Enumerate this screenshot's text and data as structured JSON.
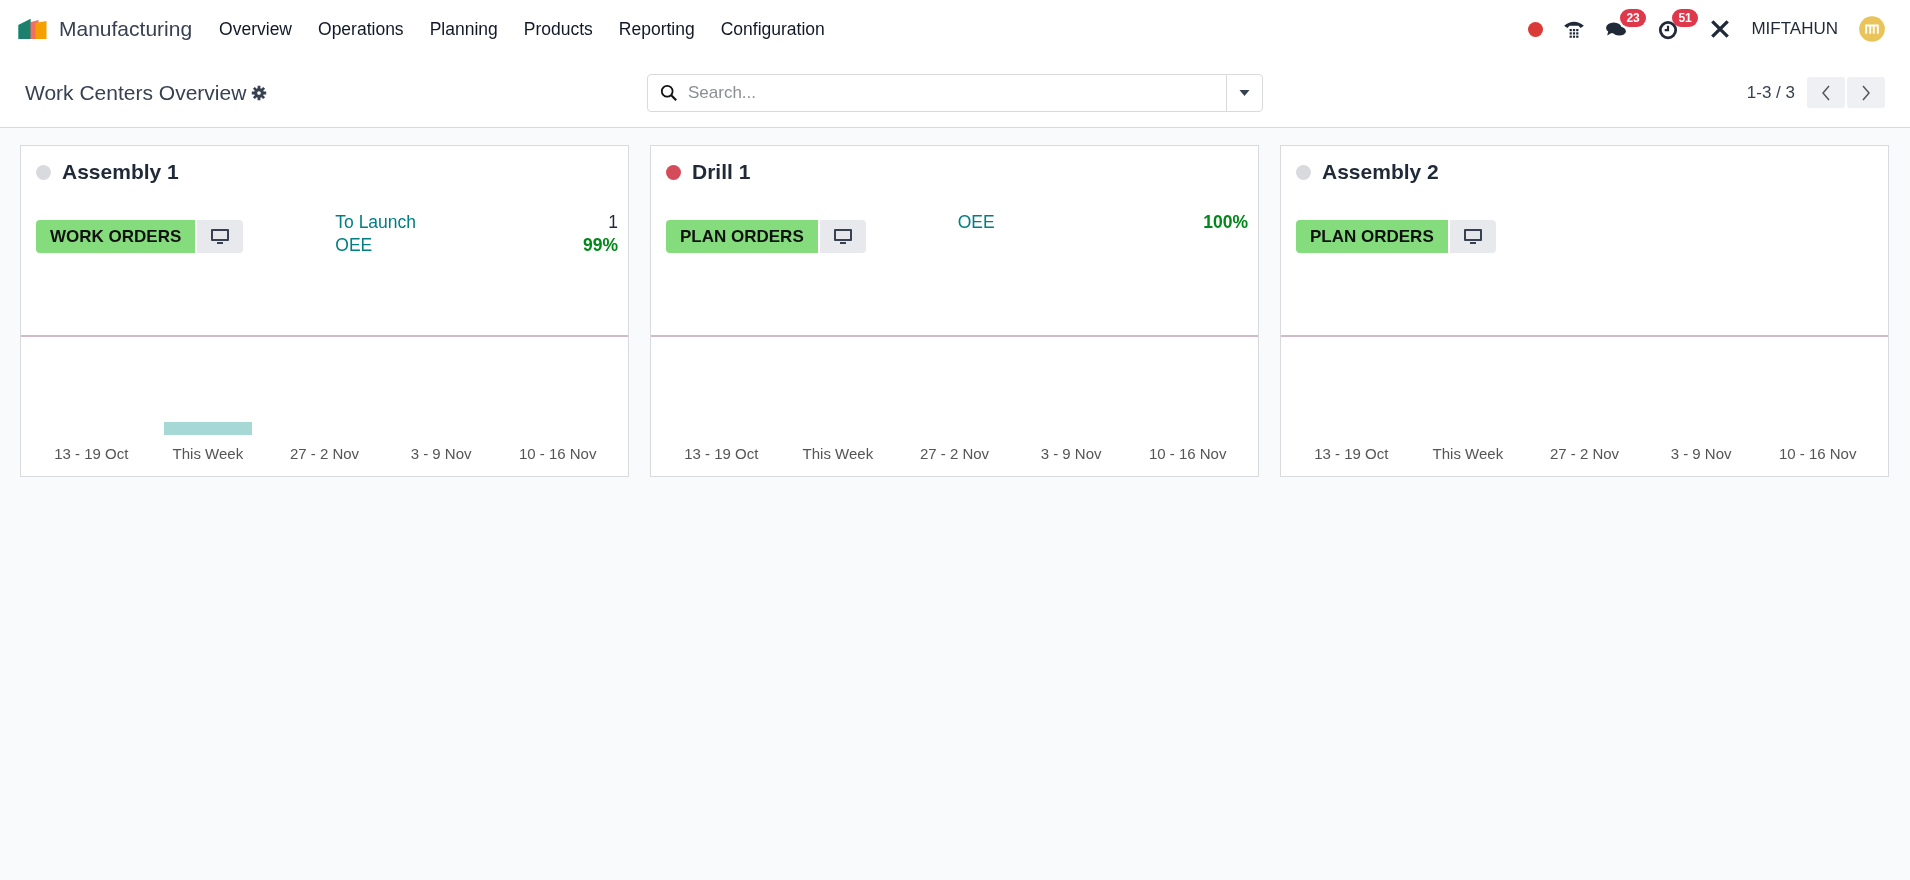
{
  "navbar": {
    "app_name": "Manufacturing",
    "menu": [
      "Overview",
      "Operations",
      "Planning",
      "Products",
      "Reporting",
      "Configuration"
    ],
    "chat_badge": "23",
    "activity_badge": "51",
    "user": "MIFTAHUN"
  },
  "control_panel": {
    "title": "Work Centers Overview",
    "search": {
      "placeholder": "Search..."
    },
    "pager": "1-3 / 3"
  },
  "cards": [
    {
      "name": "Assembly 1",
      "color": "#d8dadd",
      "button": "WORK ORDERS",
      "stats": [
        {
          "label": "To Launch",
          "value": "1",
          "kind": "count"
        },
        {
          "label": "OEE",
          "value": "99%",
          "kind": "percent"
        }
      ],
      "weeks": [
        {
          "label": "13 - 19 Oct",
          "bar": false
        },
        {
          "label": "This Week",
          "bar": true
        },
        {
          "label": "27 - 2 Nov",
          "bar": false
        },
        {
          "label": "3 - 9 Nov",
          "bar": false
        },
        {
          "label": "10 - 16 Nov",
          "bar": false
        }
      ]
    },
    {
      "name": "Drill 1",
      "color": "#d44c59",
      "button": "PLAN ORDERS",
      "stats": [
        {
          "label": "OEE",
          "value": "100%",
          "kind": "percent"
        }
      ],
      "weeks": [
        {
          "label": "13 - 19 Oct",
          "bar": false
        },
        {
          "label": "This Week",
          "bar": false
        },
        {
          "label": "27 - 2 Nov",
          "bar": false
        },
        {
          "label": "3 - 9 Nov",
          "bar": false
        },
        {
          "label": "10 - 16 Nov",
          "bar": false
        }
      ]
    },
    {
      "name": "Assembly 2",
      "color": "#d8dadd",
      "button": "PLAN ORDERS",
      "weeks": [
        {
          "label": "13 - 19 Oct",
          "bar": false
        },
        {
          "label": "This Week",
          "bar": false
        },
        {
          "label": "27 - 2 Nov",
          "bar": false
        },
        {
          "label": "3 - 9 Nov",
          "bar": false
        },
        {
          "label": "10 - 16 Nov",
          "bar": false
        }
      ]
    }
  ]
}
